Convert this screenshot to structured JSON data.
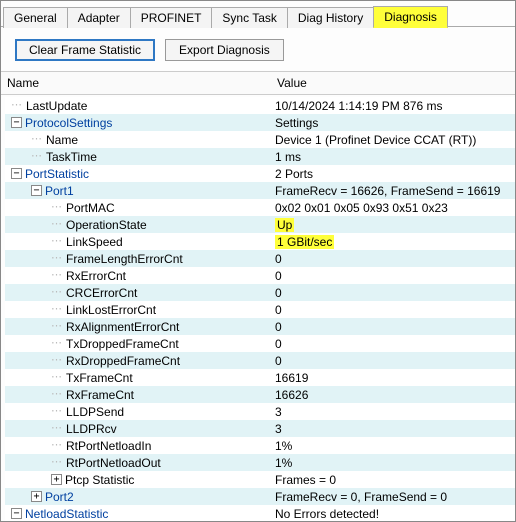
{
  "tabs": {
    "items": [
      {
        "label": "General"
      },
      {
        "label": "Adapter"
      },
      {
        "label": "PROFINET"
      },
      {
        "label": "Sync Task"
      },
      {
        "label": "Diag History"
      },
      {
        "label": "Diagnosis"
      }
    ],
    "activeIndex": 5
  },
  "toolbar": {
    "clear_label": "Clear Frame Statistic",
    "export_label": "Export Diagnosis"
  },
  "grid_header": {
    "name": "Name",
    "value": "Value"
  },
  "rows": [
    {
      "indent": 0,
      "toggle": null,
      "name": "LastUpdate",
      "value": "10/14/2024 1:14:19 PM 876 ms"
    },
    {
      "indent": 0,
      "toggle": "-",
      "name": "ProtocolSettings",
      "value": "Settings",
      "blue": true
    },
    {
      "indent": 1,
      "toggle": null,
      "name": "Name",
      "value": "Device 1 (Profinet Device CCAT (RT))"
    },
    {
      "indent": 1,
      "toggle": null,
      "name": "TaskTime",
      "value": "1 ms"
    },
    {
      "indent": 0,
      "toggle": "-",
      "name": "PortStatistic",
      "value": "2 Ports",
      "blue": true
    },
    {
      "indent": 1,
      "toggle": "-",
      "name": "Port1",
      "value": "FrameRecv = 16626, FrameSend = 16619",
      "blue": true
    },
    {
      "indent": 2,
      "toggle": null,
      "name": "PortMAC",
      "value": "0x02 0x01 0x05 0x93 0x51 0x23"
    },
    {
      "indent": 2,
      "toggle": null,
      "name": "OperationState",
      "value": "Up",
      "hlValue": true
    },
    {
      "indent": 2,
      "toggle": null,
      "name": "LinkSpeed",
      "value": "1 GBit/sec",
      "hlValue": true
    },
    {
      "indent": 2,
      "toggle": null,
      "name": "FrameLengthErrorCnt",
      "value": "0"
    },
    {
      "indent": 2,
      "toggle": null,
      "name": "RxErrorCnt",
      "value": "0"
    },
    {
      "indent": 2,
      "toggle": null,
      "name": "CRCErrorCnt",
      "value": "0"
    },
    {
      "indent": 2,
      "toggle": null,
      "name": "LinkLostErrorCnt",
      "value": "0"
    },
    {
      "indent": 2,
      "toggle": null,
      "name": "RxAlignmentErrorCnt",
      "value": "0"
    },
    {
      "indent": 2,
      "toggle": null,
      "name": "TxDroppedFrameCnt",
      "value": "0"
    },
    {
      "indent": 2,
      "toggle": null,
      "name": "RxDroppedFrameCnt",
      "value": "0"
    },
    {
      "indent": 2,
      "toggle": null,
      "name": "TxFrameCnt",
      "value": "16619"
    },
    {
      "indent": 2,
      "toggle": null,
      "name": "RxFrameCnt",
      "value": "16626"
    },
    {
      "indent": 2,
      "toggle": null,
      "name": "LLDPSend",
      "value": "3"
    },
    {
      "indent": 2,
      "toggle": null,
      "name": "LLDPRcv",
      "value": "3"
    },
    {
      "indent": 2,
      "toggle": null,
      "name": "RtPortNetloadIn",
      "value": "1%"
    },
    {
      "indent": 2,
      "toggle": null,
      "name": "RtPortNetloadOut",
      "value": "1%"
    },
    {
      "indent": 2,
      "toggle": "+",
      "name": "Ptcp Statistic",
      "value": "Frames = 0"
    },
    {
      "indent": 1,
      "toggle": "+",
      "name": "Port2",
      "value": "FrameRecv = 0, FrameSend = 0",
      "blue": true
    },
    {
      "indent": 0,
      "toggle": "-",
      "name": "NetloadStatistic",
      "value": "No Errors detected!",
      "blue": true
    }
  ]
}
